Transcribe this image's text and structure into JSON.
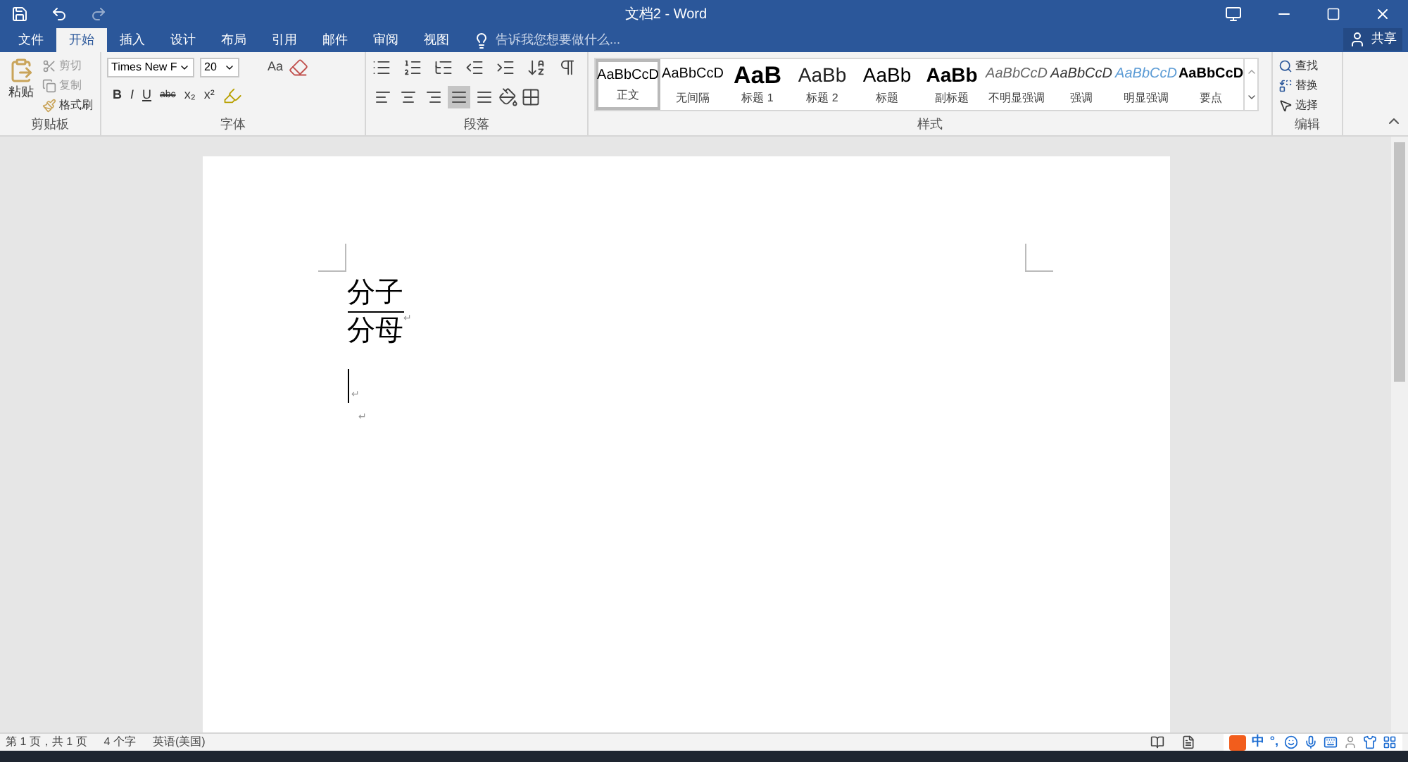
{
  "title_bar": {
    "title": "文档2 - Word"
  },
  "tabs": [
    {
      "label": "文件",
      "selected": false
    },
    {
      "label": "开始",
      "selected": true
    },
    {
      "label": "插入",
      "selected": false
    },
    {
      "label": "设计",
      "selected": false
    },
    {
      "label": "布局",
      "selected": false
    },
    {
      "label": "引用",
      "selected": false
    },
    {
      "label": "邮件",
      "selected": false
    },
    {
      "label": "审阅",
      "selected": false
    },
    {
      "label": "视图",
      "selected": false
    }
  ],
  "tell_me": {
    "placeholder": "告诉我您想要做什么..."
  },
  "share": "共享",
  "clipboard": {
    "paste": "粘贴",
    "cut": "剪切",
    "copy": "复制",
    "format_painter": "格式刷",
    "group": "剪贴板"
  },
  "font": {
    "name": "Times New F",
    "size": "20",
    "case": "Aa",
    "bold": "B",
    "italic": "I",
    "underline": "U",
    "strike": "abc",
    "subscript": "x₂",
    "superscript": "x²",
    "group": "字体"
  },
  "paragraph": {
    "alignments": [
      {
        "kind": "left",
        "selected": false
      },
      {
        "kind": "center",
        "selected": false
      },
      {
        "kind": "right",
        "selected": false
      },
      {
        "kind": "justify",
        "selected": true
      },
      {
        "kind": "distributed",
        "selected": false
      }
    ],
    "group": "段落"
  },
  "styles": {
    "items": [
      {
        "kind": "normal",
        "preview": "AaBbCcD",
        "label": "正文",
        "selected": true
      },
      {
        "kind": "no_spacing",
        "preview": "AaBbCcD",
        "label": "无间隔",
        "selected": false
      },
      {
        "kind": "heading1",
        "preview": "AaB",
        "label": "标题 1",
        "selected": false
      },
      {
        "kind": "heading2",
        "preview": "AaBb",
        "label": "标题 2",
        "selected": false
      },
      {
        "kind": "title",
        "preview": "AaBb",
        "label": "标题",
        "selected": false
      },
      {
        "kind": "subtitle",
        "preview": "AaBb",
        "label": "副标题",
        "selected": false
      },
      {
        "kind": "subtle",
        "preview": "AaBbCcD",
        "label": "不明显强调",
        "selected": false
      },
      {
        "kind": "emphasis",
        "preview": "AaBbCcD",
        "label": "强调",
        "selected": false
      },
      {
        "kind": "intense",
        "preview": "AaBbCcD",
        "label": "明显强调",
        "selected": false
      },
      {
        "kind": "strong",
        "preview": "AaBbCcD",
        "label": "要点",
        "selected": false
      }
    ],
    "group": "样式"
  },
  "editing": {
    "find": "查找",
    "replace": "替换",
    "select": "选择",
    "group": "编辑"
  },
  "document": {
    "lines": [
      {
        "kind": "fraction",
        "numerator": "分子",
        "denominator": "分母",
        "mark": "↵"
      },
      {
        "kind": "cursor",
        "mark": "↵"
      },
      {
        "kind": "empty",
        "mark": "↵"
      }
    ]
  },
  "status_bar": {
    "items": [
      "第 1 页，共 1 页",
      "4 个字",
      "英语(美国)"
    ],
    "ime": [
      "中",
      "°,"
    ]
  }
}
